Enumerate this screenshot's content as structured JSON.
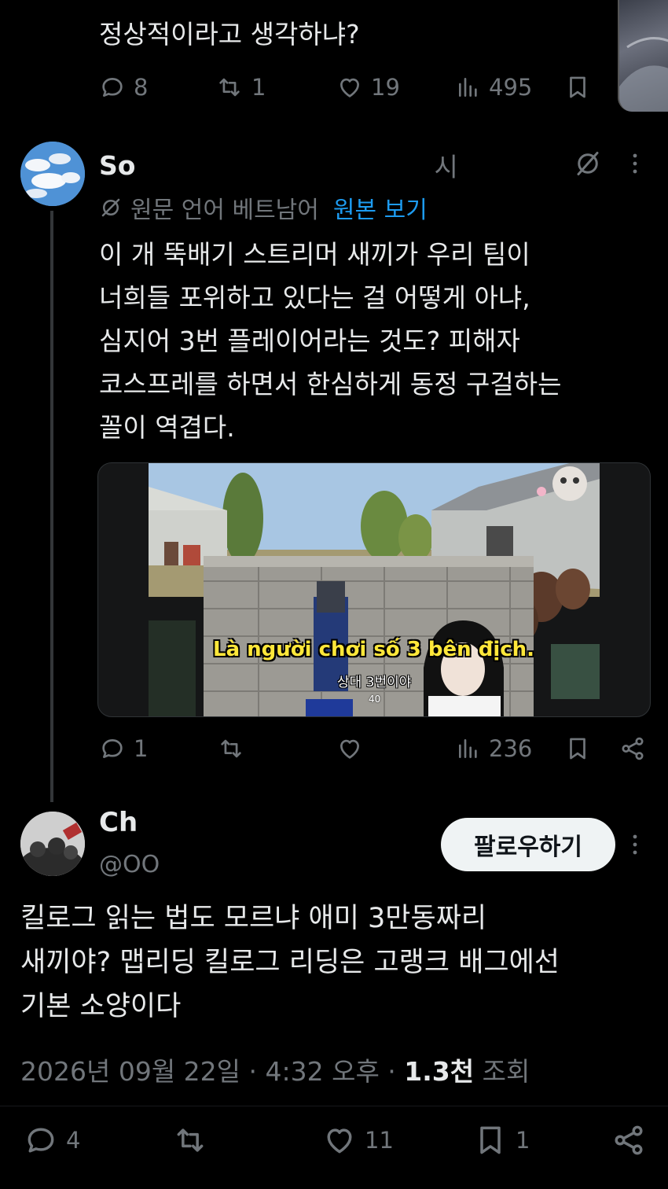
{
  "top_tweet": {
    "text": "정상적이라고 생각하냐?",
    "replies": "8",
    "reposts": "1",
    "likes": "19",
    "views": "495"
  },
  "reply_tweet": {
    "name_visible": "So",
    "time_tail": "시",
    "translate_label": "원문 언어 베트남어",
    "translate_link": "원본 보기",
    "lines": [
      "이 개 뚝배기 스트리머 새끼가 우리 팀이",
      "너희들 포위하고 있다는 걸 어떻게 아냐,",
      "심지어 3번 플레이어라는 것도? 피해자",
      "코스프레를 하면서 한심하게 동정 구걸하는",
      "꼴이 역겹다."
    ],
    "media": {
      "subtitle_vi": "Là người chơi số 3 bên địch.",
      "subtitle_ko": "상대 3번이야",
      "hud_number": "40"
    },
    "replies": "1",
    "views": "236"
  },
  "main_tweet": {
    "name_visible": "Ch",
    "handle_visible": "@OO",
    "follow_label": "팔로우하기",
    "lines": [
      "킬로그 읽는 법도 모르냐 애미 3만동짜리",
      "새끼야? 맵리딩 킬로그 리딩은 고랭크 배그에선",
      "기본 소양이다"
    ],
    "timestamp": "2026년 09월 22일 · 4:32 오후 · ",
    "views_count": "1.3천",
    "views_label": " 조회",
    "replies": "4",
    "likes": "11",
    "bookmarks": "1"
  },
  "colors": {
    "background": "#000000",
    "text": "#e7e9ea",
    "muted": "#71767b",
    "link": "#1d9bf0",
    "subtitle_yellow": "#ffe73a"
  }
}
